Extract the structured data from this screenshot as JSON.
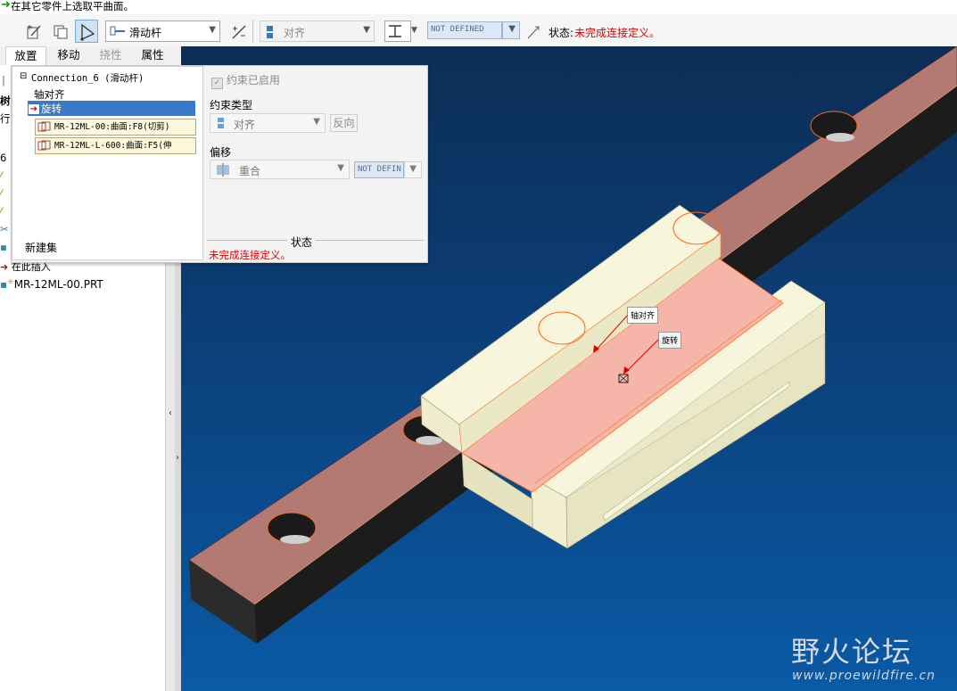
{
  "message": {
    "text": "在其它零件上选取平曲面。"
  },
  "toolbar": {
    "connection_type": "滑动杆",
    "constraint_type": "对齐",
    "offset_value": "NOT DEFINED",
    "status_label": "状态:",
    "status_value": "未完成连接定义。",
    "status_color": "#e00000"
  },
  "tabs": [
    {
      "label": "放置",
      "selected": true
    },
    {
      "label": "移动"
    },
    {
      "label": "挠性",
      "disabled": true
    },
    {
      "label": "属性"
    }
  ],
  "placement": {
    "tree": {
      "root": "Connection_6 (滑动杆)",
      "items": [
        {
          "label": "轴对齐"
        },
        {
          "label": "旋转",
          "selected": true
        }
      ],
      "references": [
        "MR-12ML-00:曲面:F8(切剪)",
        "MR-12ML-L-600:曲面:F5(伸"
      ],
      "new_set": "新建集"
    },
    "constraint_enabled": "约束已启用",
    "constraint_type_label": "约束类型",
    "constraint_type_value": "对齐",
    "flip_button": "反向",
    "offset_label": "偏移",
    "offset_value": "重合",
    "offset_field": "NOT DEFIN",
    "status_header": "状态",
    "status_text": "未完成连接定义。"
  },
  "left_tree": {
    "insert_here": "在此插入",
    "part_name": "MR-12ML-00.PRT"
  },
  "viewport": {
    "callout_axis": "轴对齐",
    "callout_rotate": "旋转"
  },
  "watermark": {
    "brand": "野火论坛",
    "url": "www.proewildfire.cn"
  }
}
